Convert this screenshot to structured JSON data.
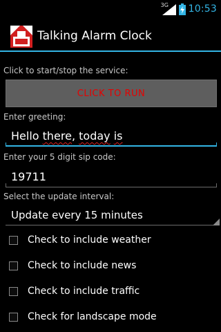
{
  "status_bar": {
    "network_type": "3G",
    "time": "10:53"
  },
  "header": {
    "title": "Talking Alarm Clock",
    "app_icon": "alarm-app-icon"
  },
  "service": {
    "label": "Click to start/stop the service:",
    "button_label": "CLICK TO RUN"
  },
  "greeting": {
    "label": "Enter greeting:",
    "words": [
      "Hello ",
      "there",
      ", ",
      "today",
      " ",
      "is"
    ]
  },
  "zip": {
    "label": "Enter your 5 digit sip code:",
    "value": "19711"
  },
  "interval": {
    "label": "Select the update interval:",
    "selected": "Update every 15 minutes"
  },
  "options": [
    {
      "label": "Check to include weather",
      "checked": false
    },
    {
      "label": "Check to include news",
      "checked": false
    },
    {
      "label": "Check to include traffic",
      "checked": false
    },
    {
      "label": "Check for landscape mode",
      "checked": false
    }
  ],
  "colors": {
    "accent": "#33b5e5",
    "button_text": "#e60000",
    "button_bg": "#5e5e5e"
  }
}
